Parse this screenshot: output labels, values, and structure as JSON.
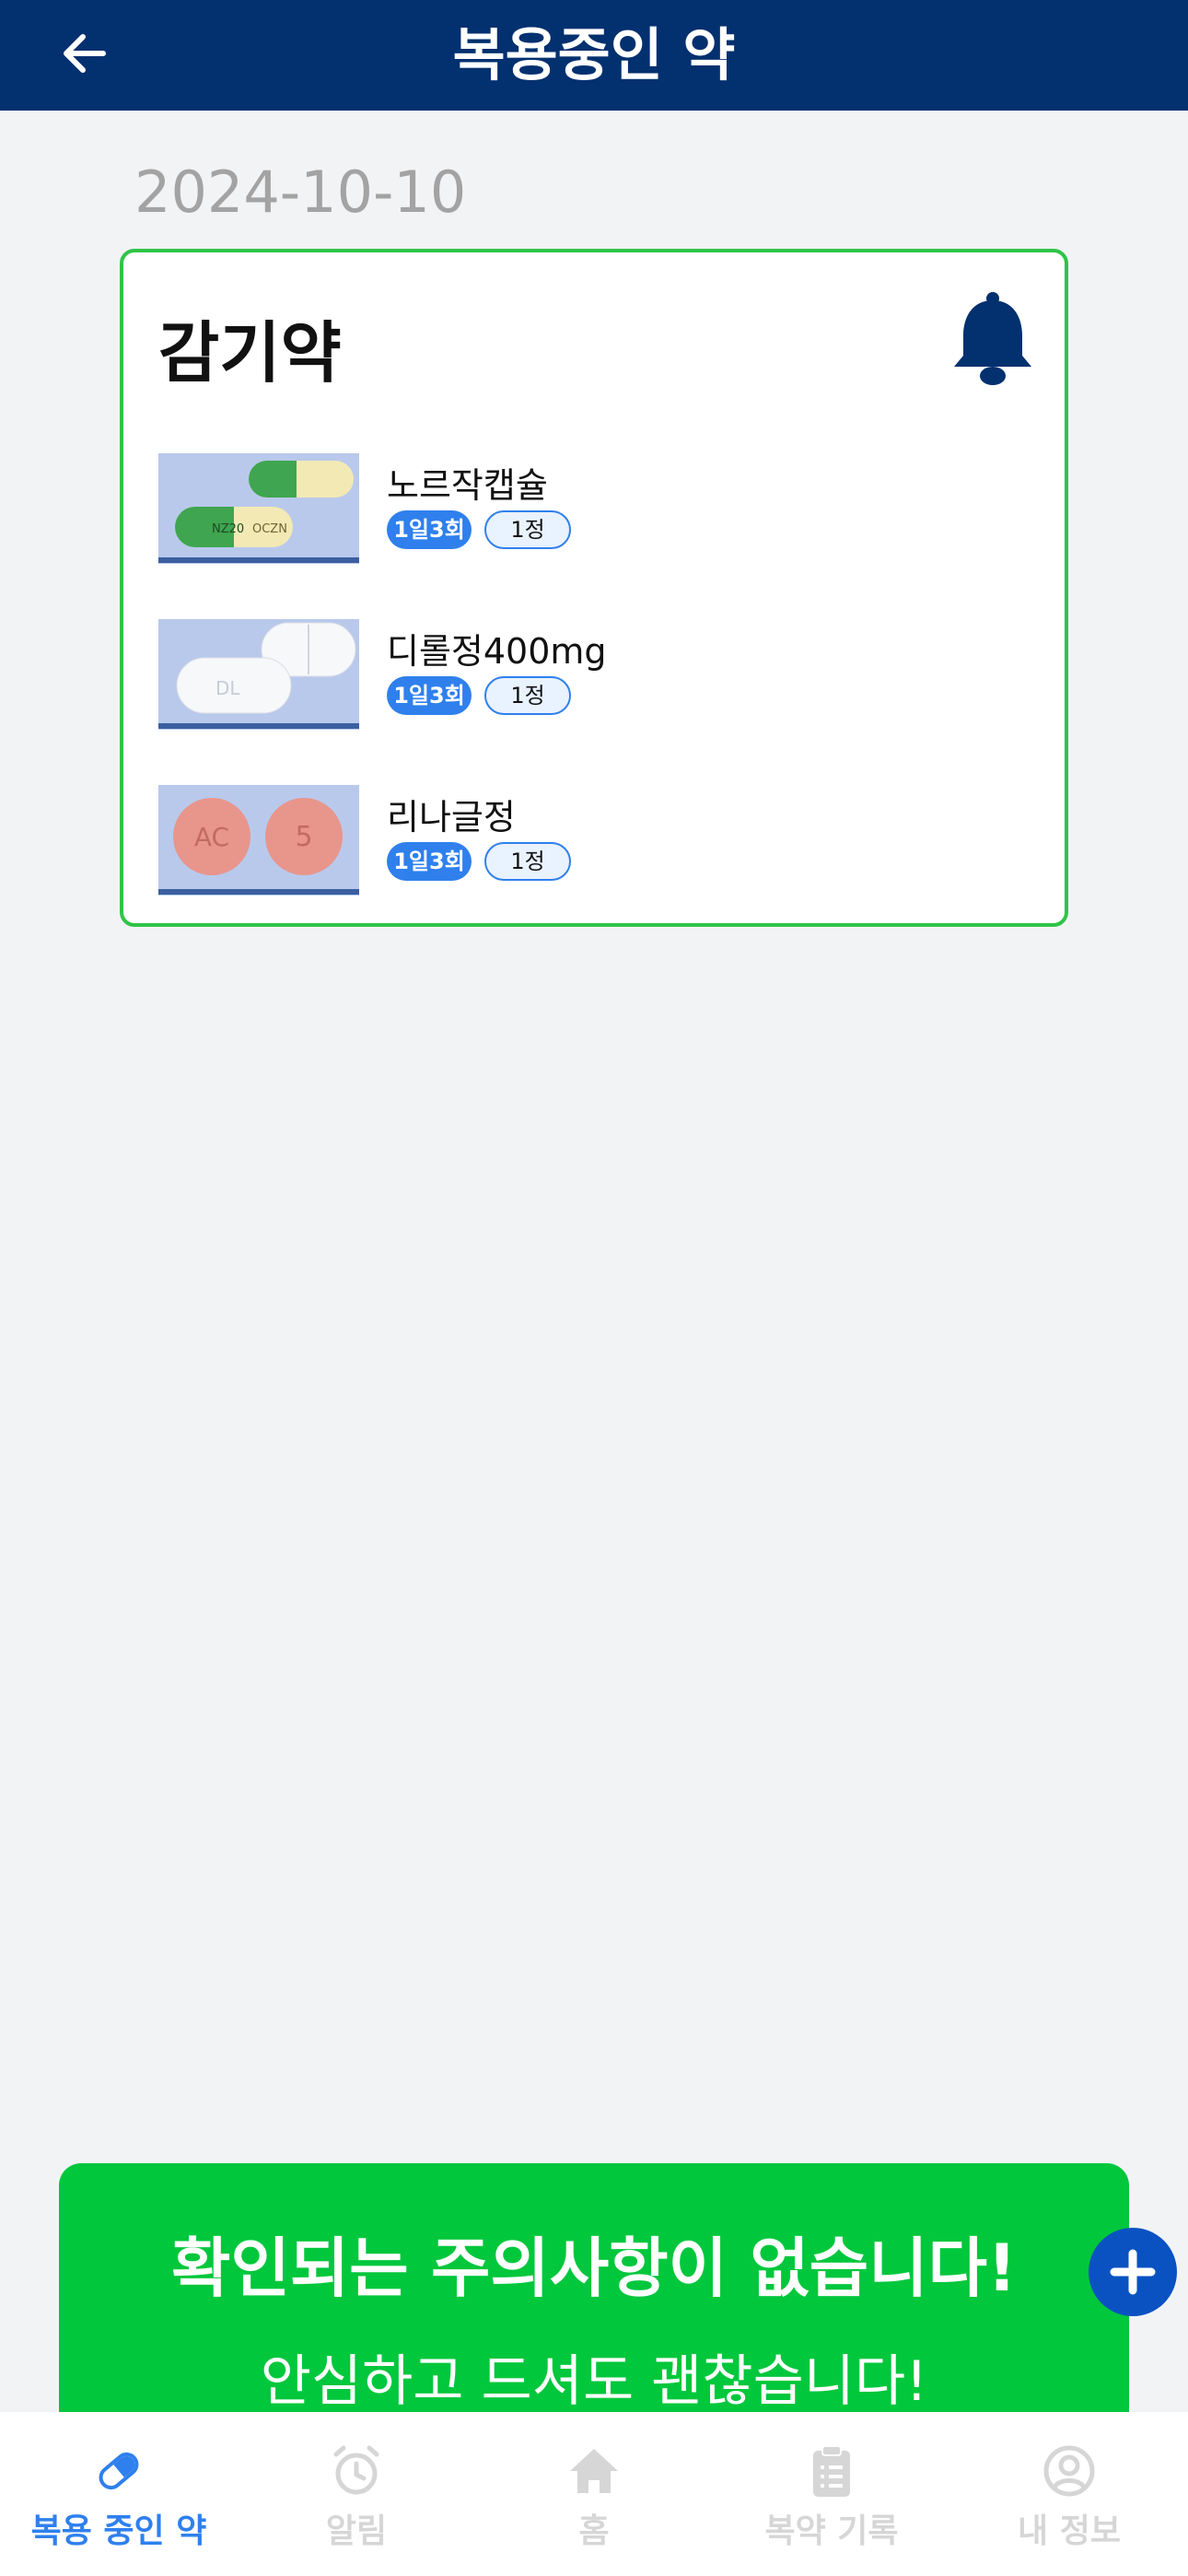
{
  "header": {
    "title": "복용중인 약"
  },
  "icons": {
    "back": "arrow-left-icon",
    "bell": "bell-icon",
    "add": "plus-icon"
  },
  "colors": {
    "header": "#03306f",
    "accent": "#2f80ed",
    "card_border": "#2ec447",
    "notice": "#00c73c",
    "fab": "#0a52c2"
  },
  "date": "2024-10-10",
  "group": {
    "title": "감기약",
    "medications": [
      {
        "name": "노르작캡슐",
        "frequency": "1일3회",
        "dose": "1정",
        "image_text": [
          "NZ20",
          "OCZN"
        ]
      },
      {
        "name": "디롤정400mg",
        "frequency": "1일3회",
        "dose": "1정",
        "image_text": [
          "DL"
        ]
      },
      {
        "name": "리나글정",
        "frequency": "1일3회",
        "dose": "1정",
        "image_text": [
          "AC",
          "5"
        ]
      }
    ]
  },
  "notice": {
    "title": "확인되는 주의사항이 없습니다!",
    "subtitle": "안심하고 드셔도 괜찮습니다!"
  },
  "tabs": [
    {
      "label": "복용 중인 약",
      "icon": "pill-icon",
      "active": true
    },
    {
      "label": "알림",
      "icon": "alarm-clock-icon",
      "active": false
    },
    {
      "label": "홈",
      "icon": "home-icon",
      "active": false
    },
    {
      "label": "복약 기록",
      "icon": "clipboard-icon",
      "active": false
    },
    {
      "label": "내 정보",
      "icon": "user-icon",
      "active": false
    }
  ]
}
